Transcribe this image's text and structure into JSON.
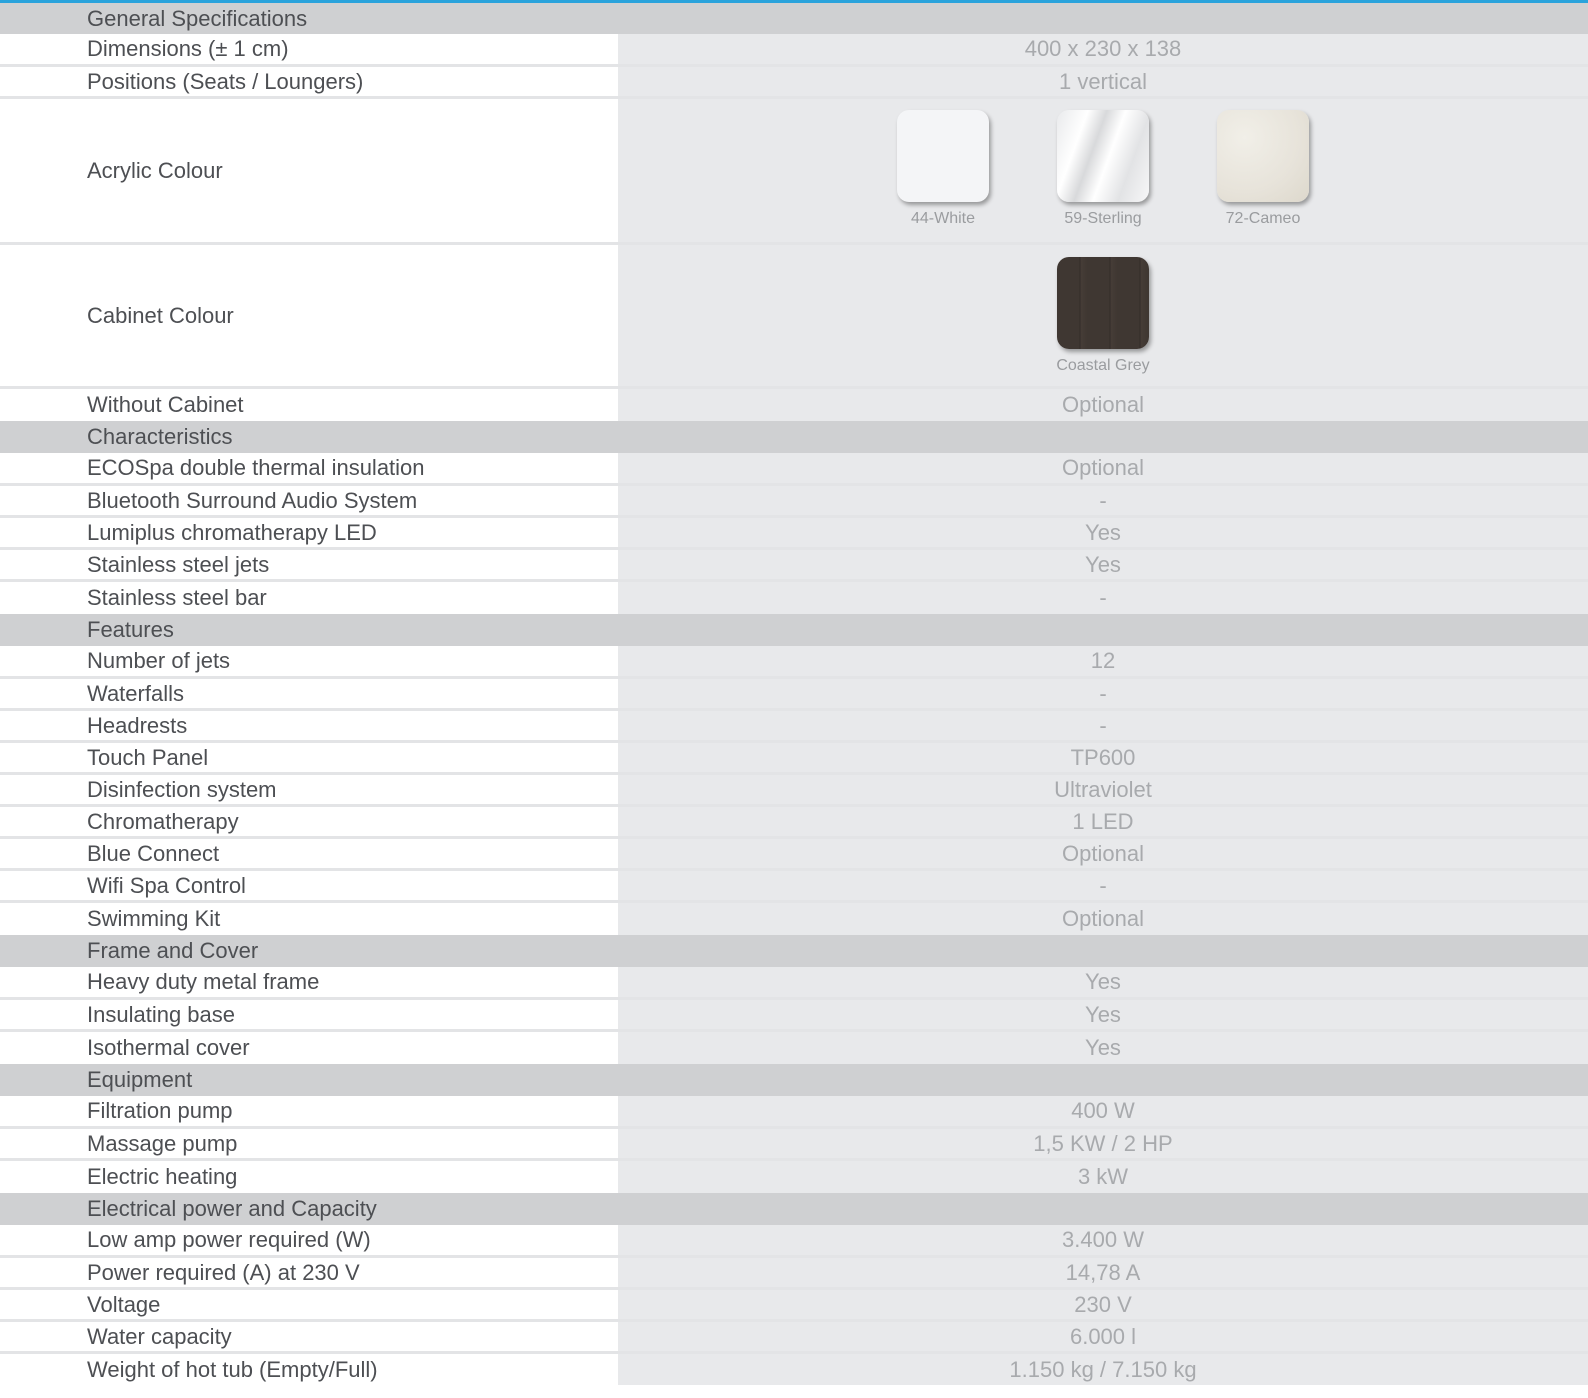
{
  "colors": {
    "accent_line": "#2aa3dc",
    "section_bg": "#cfd0d2",
    "value_bg": "#e8e9eb",
    "label_text": "#4d4f53",
    "value_text": "#a8aaad"
  },
  "general": {
    "title": "General Specifications",
    "dimensions": {
      "label": "Dimensions (± 1 cm)",
      "value": "400 x 230 x 138"
    },
    "positions": {
      "label": "Positions (Seats / Loungers)",
      "value": "1 vertical"
    },
    "acrylic": {
      "label": "Acrylic Colour",
      "swatches": [
        {
          "name": "44-White",
          "color": "#f4f5f7"
        },
        {
          "name": "59-Sterling",
          "color": "#eeeff1"
        },
        {
          "name": "72-Cameo",
          "color": "#e7e3da"
        }
      ]
    },
    "cabinet": {
      "label": "Cabinet Colour",
      "swatches": [
        {
          "name": "Coastal Grey",
          "color": "#3f3732"
        }
      ]
    },
    "without_cabinet": {
      "label": "Without Cabinet",
      "value": "Optional"
    }
  },
  "characteristics": {
    "title": "Characteristics",
    "rows": [
      {
        "label": "ECOSpa double thermal insulation",
        "value": "Optional"
      },
      {
        "label": "Bluetooth Surround Audio System",
        "value": "-"
      },
      {
        "label": "Lumiplus chromatherapy LED",
        "value": "Yes"
      },
      {
        "label": "Stainless steel jets",
        "value": "Yes"
      },
      {
        "label": "Stainless steel bar",
        "value": "-"
      }
    ]
  },
  "features": {
    "title": "Features",
    "rows": [
      {
        "label": "Number of jets",
        "value": "12"
      },
      {
        "label": "Waterfalls",
        "value": "-"
      },
      {
        "label": "Headrests",
        "value": "-"
      },
      {
        "label": "Touch Panel",
        "value": "TP600"
      },
      {
        "label": "Disinfection system",
        "value": "Ultraviolet"
      },
      {
        "label": "Chromatherapy",
        "value": "1 LED"
      },
      {
        "label": "Blue Connect",
        "value": "Optional"
      },
      {
        "label": "Wifi Spa Control",
        "value": "-"
      },
      {
        "label": "Swimming Kit",
        "value": "Optional"
      }
    ]
  },
  "frame": {
    "title": "Frame and Cover",
    "rows": [
      {
        "label": "Heavy duty metal frame",
        "value": "Yes"
      },
      {
        "label": "Insulating base",
        "value": "Yes"
      },
      {
        "label": "Isothermal cover",
        "value": "Yes"
      }
    ]
  },
  "equipment": {
    "title": "Equipment",
    "rows": [
      {
        "label": "Filtration pump",
        "value": "400 W"
      },
      {
        "label": "Massage pump",
        "value": "1,5 KW / 2 HP"
      },
      {
        "label": "Electric heating",
        "value": "3 kW"
      }
    ]
  },
  "electrical": {
    "title": "Electrical power and Capacity",
    "rows": [
      {
        "label": "Low amp power required (W)",
        "value": "3.400 W"
      },
      {
        "label": "Power required (A) at 230 V",
        "value": "14,78 A"
      },
      {
        "label": "Voltage",
        "value": "230 V"
      },
      {
        "label": "Water capacity",
        "value": "6.000 l"
      },
      {
        "label": "Weight of hot tub (Empty/Full)",
        "value": "1.150 kg / 7.150 kg"
      }
    ]
  }
}
